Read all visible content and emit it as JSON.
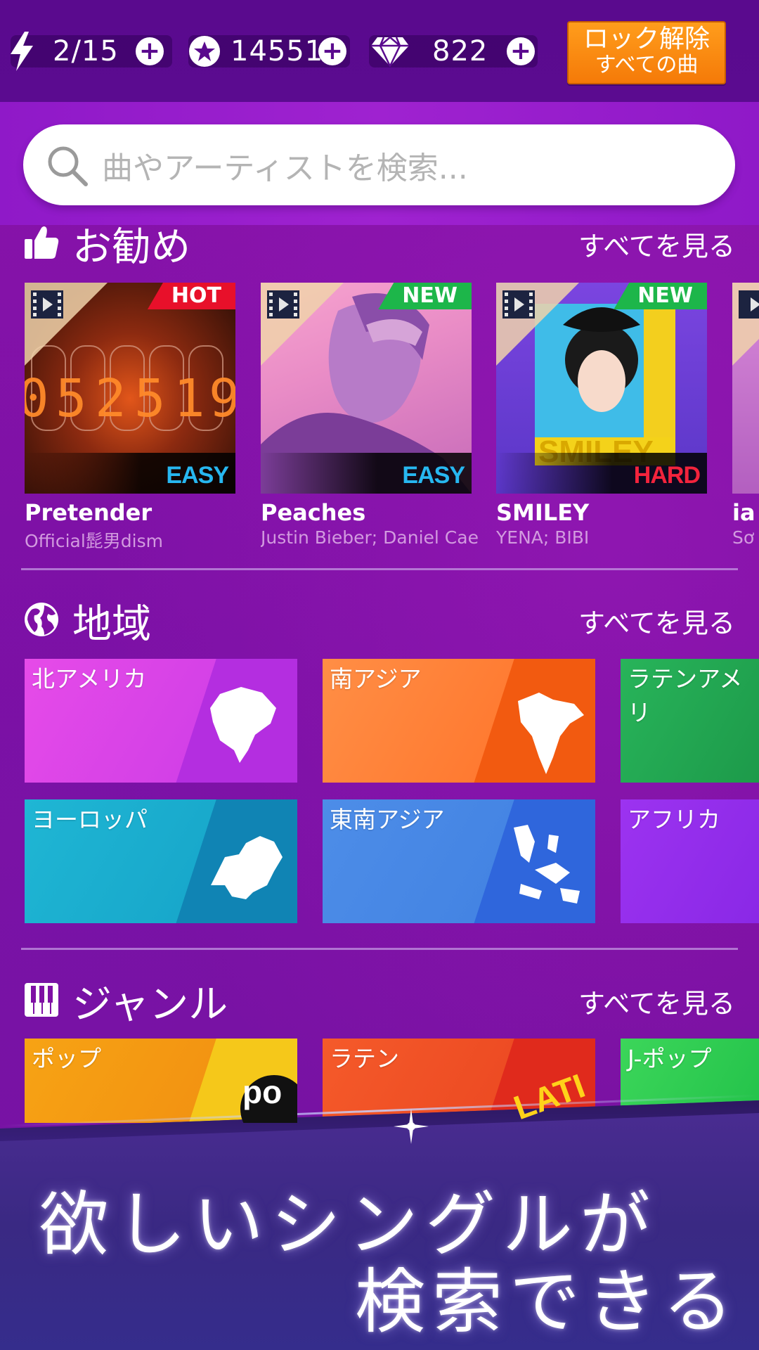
{
  "topbar": {
    "energy": "2/15",
    "stars": "14551",
    "gems": "822",
    "unlock_line1": "ロック解除",
    "unlock_line2": "すべての曲"
  },
  "search": {
    "placeholder": "曲やアーティストを検索..."
  },
  "recommended": {
    "title": "お勧め",
    "see_all": "すべてを見る",
    "songs": [
      {
        "title": "Pretender",
        "artist": "Official髭男dism",
        "tag": "HOT",
        "difficulty": "EASY"
      },
      {
        "title": "Peaches",
        "artist": "Justin Bieber; Daniel Caes",
        "tag": "NEW",
        "difficulty": "EASY"
      },
      {
        "title": "SMILEY",
        "artist": "YENA; BIBI",
        "tag": "NEW",
        "difficulty": "HARD"
      },
      {
        "title": "ia",
        "artist": "Sơ"
      }
    ]
  },
  "regions": {
    "title": "地域",
    "see_all": "すべてを見る",
    "items": [
      "北アメリカ",
      "南アジア",
      "ラテンアメリ",
      "ヨーロッパ",
      "東南アジア",
      "アフリカ"
    ]
  },
  "genres": {
    "title": "ジャンル",
    "see_all": "すべてを見る",
    "items": [
      "ポップ",
      "ラテン",
      "J-ポップ"
    ]
  },
  "promo": {
    "line1": "欲しいシングルが",
    "line2": "検索できる"
  },
  "colors": {
    "background": "#7e10a4",
    "hot": "#e8102a",
    "new": "#1db64a",
    "easy": "#27b7f0",
    "hard": "#f3233c",
    "unlock": "#f57a08"
  },
  "icons": [
    "lightning-icon",
    "star-icon",
    "diamond-icon",
    "plus-icon",
    "search-icon",
    "thumbs-up-icon",
    "globe-icon",
    "piano-icon",
    "film-icon"
  ]
}
